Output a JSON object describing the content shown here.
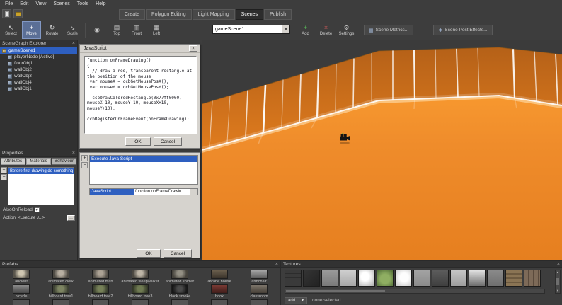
{
  "menu": {
    "items": [
      "File",
      "Edit",
      "View",
      "Scenes",
      "Tools",
      "Help"
    ]
  },
  "mode_tabs": {
    "items": [
      "Create",
      "Polygon Editing",
      "Light Mapping",
      "Scenes",
      "Publish"
    ],
    "active": "Scenes"
  },
  "toolbar": {
    "tools": [
      {
        "label": "Select",
        "icon": "↖"
      },
      {
        "label": "Move",
        "icon": "+"
      },
      {
        "label": "Rotate",
        "icon": "↻"
      },
      {
        "label": "Scale",
        "icon": "↘"
      }
    ],
    "active_tool": "Move",
    "camera_view_icon": "◉",
    "views": [
      {
        "label": "Top",
        "icon": "▤"
      },
      {
        "label": "Front",
        "icon": "▥"
      },
      {
        "label": "Left",
        "icon": "▦"
      }
    ],
    "scene_selector": "gameScene1",
    "actions": [
      {
        "label": "Add",
        "icon": "+"
      },
      {
        "label": "Delete",
        "icon": "×"
      },
      {
        "label": "Settings",
        "icon": "⚙"
      }
    ],
    "scene_metrics_label": "Scene Metrics...",
    "scene_post_effects_label": "Scene Post Effects...",
    "metrics_icon": "▦",
    "post_effects_icon": "❖"
  },
  "scenegraph": {
    "title": "SceneGraph Explorer",
    "items": [
      {
        "label": "gameScene1"
      },
      {
        "label": "playerNode [Active]"
      },
      {
        "label": "floorObj1"
      },
      {
        "label": "wallObj2"
      },
      {
        "label": "wallObj3"
      },
      {
        "label": "wallObj4"
      },
      {
        "label": "wallObj1"
      }
    ]
  },
  "properties": {
    "title": "Properties",
    "tabs": [
      "Attributes",
      "Materials",
      "Behaviour"
    ],
    "active_tab": "Behaviour",
    "selected_behavior": "Before first drawing do something",
    "also_on_reload_label": "AlsoOnReload",
    "also_on_reload_checked": true,
    "action_label": "Action",
    "action_value": "<Execute J...>"
  },
  "js_dialog": {
    "title": "JavaScript",
    "code": "function onFrameDrawing()\n{\n  // draw a red, transparent rectangle at the position of the mouse\n var mouseX = ccbGetMousePosX();\n var mouseY = ccbGetMousePosY();\n\n  ccbDrawColoredRectangle(0x77ff0000, mouseX-10, mouseY-10, mouseX+10, mouseY+10);\n\nccbRegisterOnFrameEvent(onFrameDrawing);",
    "ok_label": "OK",
    "cancel_label": "Cancel"
  },
  "behavior_dialog": {
    "list_item": "Execute Java Script",
    "property_name": "JavaScript",
    "property_value": "function onFrameDrawin",
    "ellipsis": "...",
    "ok_label": "OK",
    "cancel_label": "Cancel"
  },
  "prefabs": {
    "title": "Prefabs",
    "row1": [
      "ancient",
      "animated clerk",
      "animated man",
      "animated sleepwalker",
      "animated soldier",
      "arcane house",
      "armchair"
    ],
    "row2": [
      "bicycle",
      "billboard tree1",
      "billboard tree2",
      "billboard tree3",
      "black smoke",
      "book",
      "classroom"
    ]
  },
  "textures": {
    "title": "Textures",
    "add_label": "add...",
    "status": "none selected"
  },
  "icons": {
    "close": "×",
    "combo_arrow": "▼",
    "dropdown_arrow": "▾",
    "plus": "+",
    "minus": "−",
    "check": "✓",
    "up": "▲",
    "down": "▼"
  },
  "colors": {
    "selection_blue": "#2e5fc0",
    "viewport_floor_orange": "#ef8c2b",
    "viewport_wall_orange": "#d4741e",
    "dialog_gray": "#d6d3ce",
    "panel_dark": "#3d3d3d"
  }
}
